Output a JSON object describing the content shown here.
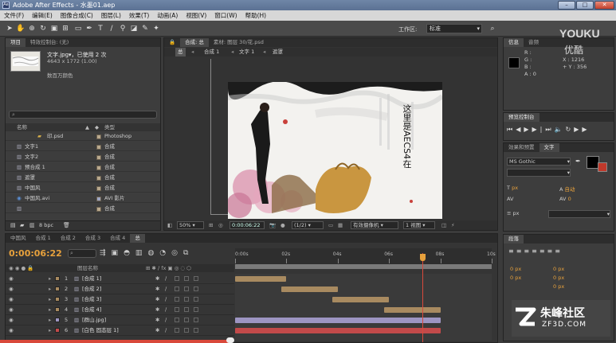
{
  "window": {
    "title": "Adobe After Effects - 水墨01.aep",
    "app_icon": "Ae"
  },
  "watermarks": {
    "youku": "YOUKU",
    "youku_cn": "优酷",
    "zf3d_cn": "朱峰社区",
    "zf3d_url": "ZF3D.COM"
  },
  "menu": [
    "文件(F)",
    "编辑(E)",
    "图像合成(C)",
    "图层(L)",
    "效果(T)",
    "动画(A)",
    "视图(V)",
    "窗口(W)",
    "帮助(H)"
  ],
  "toolbar": {
    "workspace_label": "工作区:",
    "workspace_value": "标准"
  },
  "project": {
    "tabs": [
      "项目",
      "特效控制台: (无)"
    ],
    "selected_name": "文字.jpg▾，已使用 2 次",
    "selected_size": "4643 x 1772 (1.00)",
    "selected_color": "数百万颜色",
    "col_name": "名称",
    "col_type": "类型",
    "items": [
      {
        "name": "印.psd",
        "type": "Photoshop"
      },
      {
        "name": "文字1",
        "type": "合成"
      },
      {
        "name": "文字2",
        "type": "合成"
      },
      {
        "name": "预合成 1",
        "type": "合成"
      },
      {
        "name": "遮罩",
        "type": "合成"
      },
      {
        "name": "中国风",
        "type": "合成"
      },
      {
        "name": "中国风.avi",
        "type": "AVI 影片"
      },
      {
        "name": "总",
        "type": "合成"
      }
    ],
    "bpc": "8 bpc"
  },
  "composition": {
    "tabs": [
      "合成: 总",
      "素材: 图层 30/花.psd"
    ],
    "breadcrumbs": [
      "总",
      "合成 1",
      "文字 1",
      "遮罩"
    ],
    "overlay_text": "这里是AECS4在",
    "zoom": "50%",
    "timecode": "0:00:06:22",
    "resolution": "(1/2)",
    "camera": "有效摄像机",
    "views": "1 视图"
  },
  "info": {
    "tabs": [
      "信息",
      "音频"
    ],
    "r": "R :",
    "g": "G :",
    "b": "B :",
    "a": "A : 0",
    "x": "X : 1216",
    "y": "+ Y : 356"
  },
  "preview": {
    "tab": "预览控制台"
  },
  "character": {
    "tabs": [
      "效果和预置",
      "文字"
    ],
    "font": "MS Gothic",
    "unit_px": "px",
    "size": "px",
    "auto": "自动",
    "tracking": "0"
  },
  "paragraph": {
    "tab": "段落",
    "values": [
      "0 px",
      "0 px",
      "0 px",
      "0 px",
      "0 px"
    ]
  },
  "timeline": {
    "tabs": [
      "中国风",
      "合成 1",
      "合成 2",
      "合成 3",
      "合成 4",
      "总"
    ],
    "timecode": "0:00:06:22",
    "col_name": "图层名称",
    "ruler": [
      "0:00s",
      "02s",
      "04s",
      "06s",
      "08s",
      "10s"
    ],
    "playhead_seconds": 7.3,
    "duration_seconds": 10,
    "layers": [
      {
        "num": "1",
        "name": "[合成 1]",
        "color": "#a88a60",
        "start": 0.0,
        "end": 2.0
      },
      {
        "num": "2",
        "name": "[合成 2]",
        "color": "#a88a60",
        "start": 1.8,
        "end": 4.0
      },
      {
        "num": "3",
        "name": "[合成 3]",
        "color": "#a88a60",
        "start": 3.8,
        "end": 6.0
      },
      {
        "num": "4",
        "name": "[合成 4]",
        "color": "#a88a60",
        "start": 5.8,
        "end": 8.0
      },
      {
        "num": "5",
        "name": "[群山.jpg]",
        "color": "#9d95c2",
        "start": 0.0,
        "end": 8.0
      },
      {
        "num": "6",
        "name": "[白色 固态层 1]",
        "color": "#c24a4a",
        "start": 0.0,
        "end": 8.0
      }
    ]
  }
}
